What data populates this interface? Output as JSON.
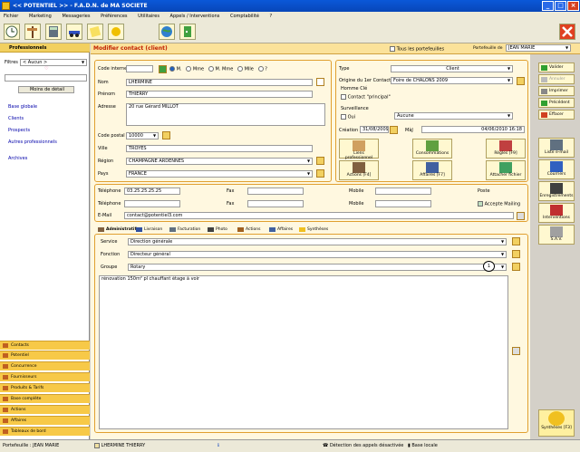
{
  "window": {
    "title": "<< POTENTIEL >> - F.A.D.N. de MA SOCIETE"
  },
  "menu": [
    "Fichier",
    "Marketing",
    "Messageries",
    "Préférences",
    "Utilitaires",
    "Appels / Interventions",
    "Comptabilité",
    "?"
  ],
  "header": {
    "title": "Modifier contact (client)",
    "all_wallets": "Tous les portefeuilles",
    "wallet_label": "Portefeuille de",
    "wallet_value": "JEAN MARIE"
  },
  "sidebar": {
    "title": "Professionnels",
    "filter_label": "Filtres",
    "filter_value": "< Aucun >",
    "less_detail": "Moins de détail",
    "links": [
      "Base globale",
      "Clients",
      "Prospects",
      "Autres professionnels",
      "Archives"
    ],
    "bottom": [
      "Contacts",
      "Potentiel",
      "Concurrence",
      "Fournisseurs",
      "Produits & Tarifs",
      "Base complète",
      "Actions",
      "Affaires",
      "Tableaux de bord"
    ]
  },
  "identity": {
    "code_interne_label": "Code interne",
    "civ": [
      "M.",
      "Mme",
      "M. Mme",
      "Mlle",
      "?"
    ],
    "nom_label": "Nom",
    "nom": "LHERMINE",
    "prenom_label": "Prénom",
    "prenom": "THIERRY",
    "adresse_label": "Adresse",
    "adresse": "20 rue Gérard MILLOT",
    "cp_label": "Code postal",
    "cp": "10000",
    "ville_label": "Ville",
    "ville": "TROYES",
    "region_label": "Région",
    "region": "CHAMPAGNE ARDENNES",
    "pays_label": "Pays",
    "pays": "FRANCE"
  },
  "type_box": {
    "type_label": "Type",
    "type": "Client",
    "origine_label": "Origine du 1er Contact",
    "origine": "Foire de CHALONS 2009",
    "homme_cle": "Homme Clé",
    "contact_principal": "Contact \"principal\"",
    "surveillance": "Surveillance",
    "oui": "Oui",
    "surveillance_value": "Aucune",
    "creation_label": "Création",
    "creation": "31/08/2009",
    "maj_label": "MàJ",
    "maj": "04/06/2010 16:18"
  },
  "actions": [
    "Liens professionnel",
    "Consommations",
    "Règles [F9]",
    "Actions [F4]",
    "Affaires [F7]",
    "Attacher fichier"
  ],
  "phones": {
    "tel_label": "Téléphone",
    "tel1": "03.25.25.25.25",
    "tel2": "",
    "fax_label": "Fax",
    "mobile_label": "Mobile",
    "poste_label": "Poste",
    "accepte_mailing": "Accepte Mailing",
    "email_label": "E-Mail",
    "email": "contact@potentiel3.com"
  },
  "tabs": [
    "Administratif",
    "Livraison",
    "Facturation",
    "Photo",
    "Actions",
    "Affaires",
    "Synthèses"
  ],
  "admin": {
    "service_label": "Service",
    "service": "Direction générale",
    "fonction_label": "Fonction",
    "fonction": "Directeur général",
    "groupe_label": "Groupe",
    "groupe": "Rotary",
    "groupe_count": "1",
    "note": "rénovation 150m² pl chauffant  étage à voir"
  },
  "right_buttons": [
    "Valider",
    "Annuler",
    "Imprimer",
    "Précédent",
    "Effacer"
  ],
  "right_big": [
    "Liste e-mail",
    "Courriers",
    "Enregistrements",
    "Interventions",
    "S.A.V."
  ],
  "synth_button": "Synthèses [F3]",
  "status": {
    "portefeuille": "Portefeuille : JEAN MARIE",
    "contact": "LHERMINE THIERRY",
    "detection": "Détection des appels désactivée",
    "base": "Base locale"
  },
  "colors": {
    "accent": "#f2d060",
    "title_bar": "#0a58d8",
    "heading_red": "#c02000"
  }
}
